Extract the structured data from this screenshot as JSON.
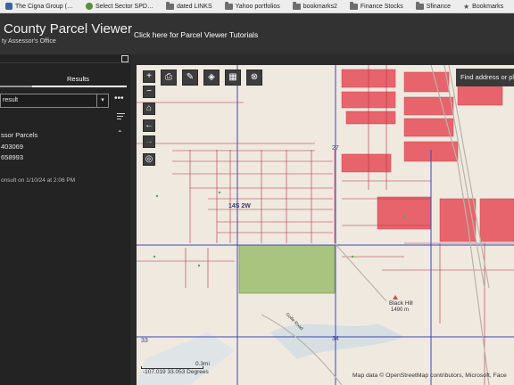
{
  "bookmarks": [
    {
      "label": "The Cigna Group (…",
      "icon": "cigna-icon",
      "color": "#3a62a8"
    },
    {
      "label": "Select Sector SPD…",
      "icon": "spdr-icon",
      "color": "#5a8f3a"
    },
    {
      "label": "dated LINKS",
      "icon": "folder-icon"
    },
    {
      "label": "Yahoo portfolios",
      "icon": "folder-icon"
    },
    {
      "label": "bookmarks2",
      "icon": "folder-icon"
    },
    {
      "label": "Finance Stocks",
      "icon": "folder-icon"
    },
    {
      "label": "Sfinance",
      "icon": "folder-icon"
    },
    {
      "label": "Bookmarks",
      "icon": "star-icon"
    }
  ],
  "header": {
    "title": "County Parcel Viewer",
    "subtitle": "ty Assessor's Office",
    "tutorial_link": "Click here for Parcel Viewer Tutorials"
  },
  "panel": {
    "tab_label": "Results",
    "select_value": "result",
    "more_label": "•••",
    "group_title": "ssor Parcels",
    "parcels": [
      "403069",
      "658993"
    ],
    "as_of": "onsult on 1/10/24 at 2:06 PM"
  },
  "map": {
    "search_placeholder": "Find address or pl",
    "township_label": "14S 2W",
    "section_27": "27",
    "section_33": "33",
    "section_34": "34",
    "black_hill": "Black Hill",
    "black_hill_elev": "1490 m",
    "road_label": "Golfe Road",
    "scale_label": "0.3mi",
    "coordinates": "-107.019 33.053 Degrees",
    "attribution": "Map data © OpenStreetMap contributors, Microsoft, Face",
    "colors": {
      "background": "#efe9e0",
      "selected_parcel": "#a9c47f",
      "parcel_line": "#b5323c",
      "section_line": "#3b47b8",
      "dense_lots": "#e8646c",
      "water": "#d7dfe3"
    }
  },
  "toolbar": {
    "zoom_in": "+",
    "zoom_out": "−"
  }
}
